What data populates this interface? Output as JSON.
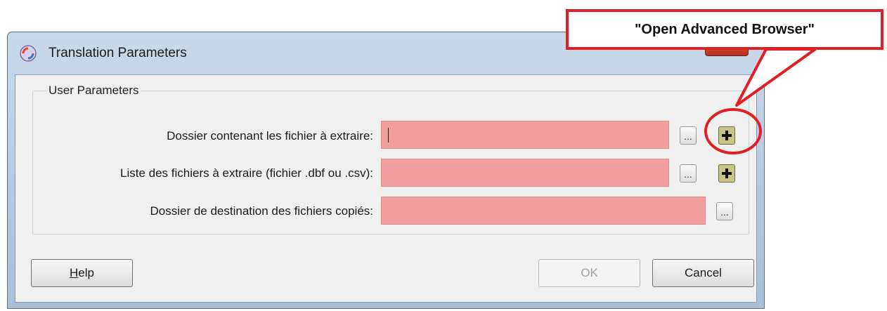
{
  "window": {
    "title": "Translation Parameters"
  },
  "group": {
    "title": "User Parameters"
  },
  "rows": [
    {
      "label": "Dossier contenant les fichier à extraire:",
      "value": "",
      "browse_label": "...",
      "has_advanced": true
    },
    {
      "label": "Liste des fichiers à extraire (fichier .dbf ou .csv):",
      "value": "",
      "browse_label": "...",
      "has_advanced": true
    },
    {
      "label": "Dossier de destination des fichiers copiés:",
      "value": "",
      "browse_label": "...",
      "has_advanced": false
    }
  ],
  "buttons": {
    "help": "Help",
    "ok": "OK",
    "cancel": "Cancel"
  },
  "annotation": {
    "text": "\"Open Advanced Browser\"",
    "color": "#e01e24"
  },
  "icons": {
    "app": "fme-app-icon",
    "advanced": "plus-icon"
  },
  "colors": {
    "required_field": "#f19e9e"
  }
}
